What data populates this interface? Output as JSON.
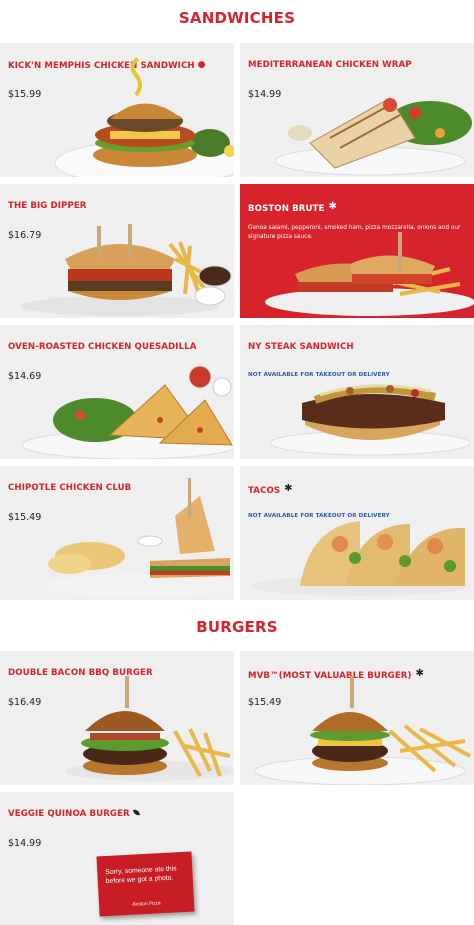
{
  "sections": {
    "sandwiches": "SANDWICHES",
    "burgers": "BURGERS"
  },
  "colors": {
    "brand_red": "#d7232b",
    "card_bg": "#efefef",
    "note_blue": "#2b57b5"
  },
  "items": [
    {
      "name": "KICK'N MEMPHIS CHICKEN SANDWICH",
      "price": "$15.99",
      "badge": "spicy-drop-icon"
    },
    {
      "name": "MEDITERRANEAN CHICKEN WRAP",
      "price": "$14.99"
    },
    {
      "name": "THE BIG DIPPER",
      "price": "$16.79"
    },
    {
      "name": "BOSTON BRUTE",
      "badge": "star-icon",
      "description": "Genoa salami, pepperoni, smoked ham, pizza mozzarella, onions and our signature pizza sauce."
    },
    {
      "name": "OVEN-ROASTED CHICKEN QUESADILLA",
      "price": "$14.69"
    },
    {
      "name": "NY STEAK SANDWICH",
      "note": "NOT AVAILABLE FOR TAKEOUT OR DELIVERY"
    },
    {
      "name": "CHIPOTLE CHICKEN CLUB",
      "price": "$15.49"
    },
    {
      "name": "TACOS",
      "badge": "star-icon",
      "note": "NOT AVAILABLE FOR TAKEOUT OR DELIVERY"
    },
    {
      "name": "DOUBLE BACON BBQ BURGER",
      "price": "$16.49"
    },
    {
      "name": "MVB™(MOST VALUABLE BURGER)",
      "price": "$15.49",
      "badge": "star-icon"
    },
    {
      "name": "VEGGIE QUINOA BURGER",
      "price": "$14.99",
      "badge": "leaf-icon",
      "placeholder": {
        "text": "Sorry, someone ate this before we got a photo.",
        "signature": "-Boston Pizza"
      }
    }
  ]
}
